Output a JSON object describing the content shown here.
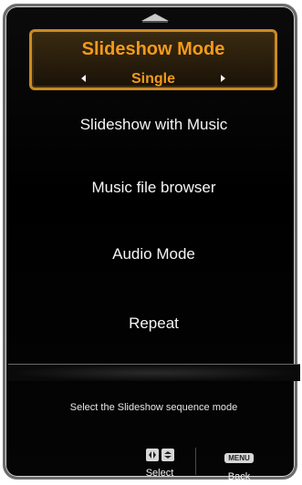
{
  "selected_item": {
    "title": "Slideshow Mode",
    "value": "Single"
  },
  "menu_items": [
    {
      "label": "Slideshow with Music"
    },
    {
      "label": "Music file browser"
    },
    {
      "label": "Audio Mode"
    },
    {
      "label": "Repeat"
    }
  ],
  "description": "Select the Slideshow sequence mode",
  "footer": {
    "select": {
      "label": "Select",
      "icons": [
        "left-right-arrows-icon",
        "up-down-arrows-icon"
      ]
    },
    "back": {
      "label": "Back",
      "key_text": "MENU"
    }
  },
  "colors": {
    "accent": "#f39a1a",
    "text": "#f5f5f5",
    "panel": "#000000"
  }
}
